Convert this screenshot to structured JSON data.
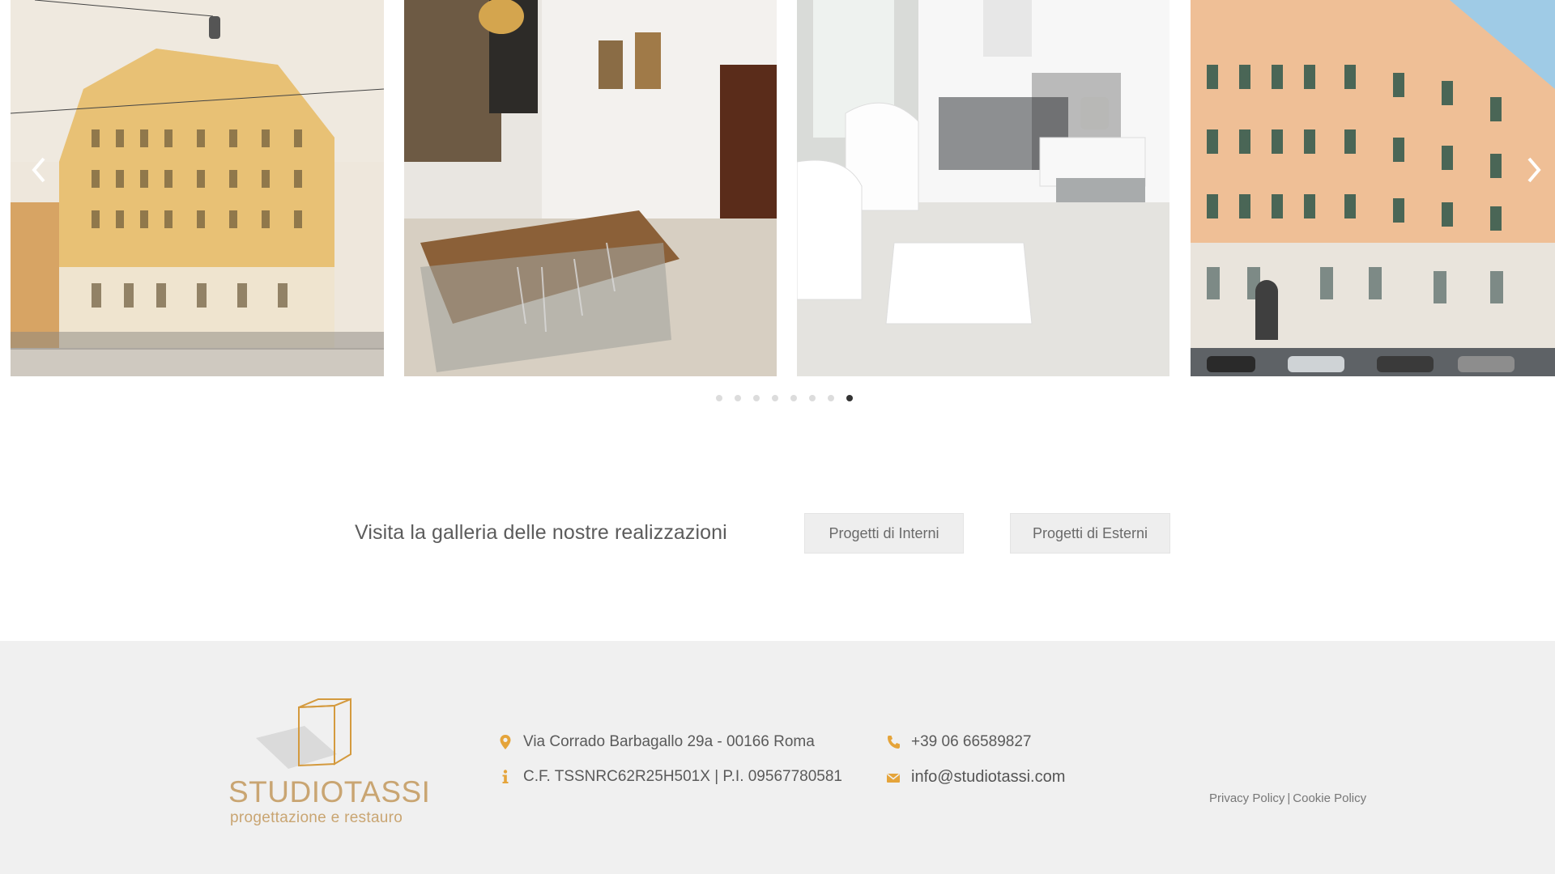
{
  "carousel": {
    "slides": [
      {
        "alt": "palazzo-giallo"
      },
      {
        "alt": "sala-da-pranzo"
      },
      {
        "alt": "soggiorno-bianco"
      },
      {
        "alt": "palazzo-rosa"
      }
    ],
    "prev_icon": "chevron-left-icon",
    "next_icon": "chevron-right-icon",
    "dot_count": 8,
    "active_dot": 8
  },
  "gallery": {
    "text": "Visita la galleria delle nostre realizzazioni",
    "btn_interni": "Progetti di Interni",
    "btn_esterni": "Progetti di Esterni"
  },
  "footer": {
    "logo": {
      "name_a": "STUDIO",
      "name_b": "TASSI",
      "tagline": "progettazione e restauro"
    },
    "address": "Via Corrado Barbagallo 29a - 00166 Roma",
    "fiscal": "C.F. TSSNRC62R25H501X | P.I. 09567780581",
    "phone": "+39 06 66589827",
    "email": "info@studiotassi.com",
    "privacy": "Privacy Policy",
    "separator": "|",
    "cookie": "Cookie Policy"
  },
  "colors": {
    "accent": "#e5a43a",
    "footer_bg": "#f0f0f0",
    "logo": "#c9a572"
  }
}
